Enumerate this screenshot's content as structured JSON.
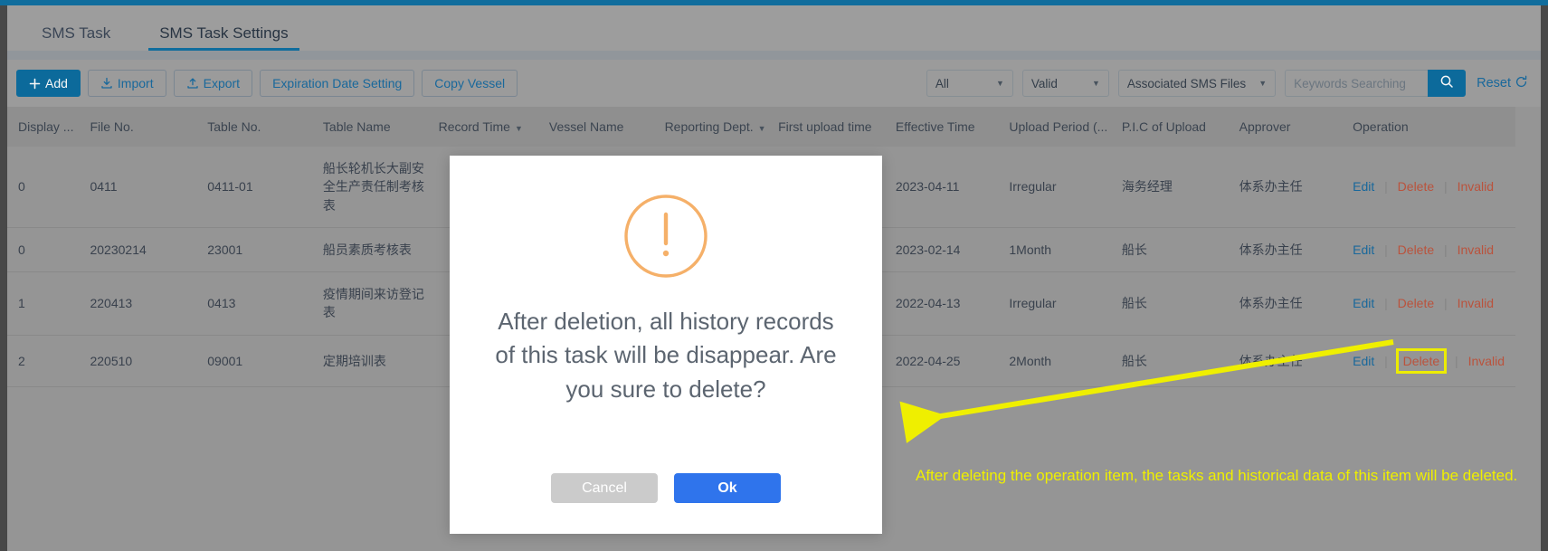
{
  "window": {
    "accent_blue": "#1171a3",
    "page_bg": "#9a9a9a"
  },
  "tabs": [
    {
      "label": "SMS Task",
      "active": false
    },
    {
      "label": "SMS Task Settings",
      "active": true
    }
  ],
  "toolbar": {
    "add_label": "Add",
    "import_label": "Import",
    "export_label": "Export",
    "expiration_label": "Expiration Date Setting",
    "copy_vessel_label": "Copy Vessel",
    "filter_all": "All",
    "filter_valid": "Valid",
    "filter_files": "Associated SMS Files",
    "search_placeholder": "Keywords Searching",
    "search_value": "",
    "reset_label": "Reset"
  },
  "table": {
    "columns": [
      {
        "label": "Display ...",
        "sortable": false
      },
      {
        "label": "File No.",
        "sortable": false
      },
      {
        "label": "Table No.",
        "sortable": false
      },
      {
        "label": "Table Name",
        "sortable": false
      },
      {
        "label": "Record Time",
        "sortable": true
      },
      {
        "label": "Vessel Name",
        "sortable": false
      },
      {
        "label": "Reporting Dept.",
        "sortable": true
      },
      {
        "label": "First upload time",
        "sortable": false
      },
      {
        "label": "Effective Time",
        "sortable": false
      },
      {
        "label": "Upload Period (...",
        "sortable": false
      },
      {
        "label": "P.I.C of Upload",
        "sortable": false
      },
      {
        "label": "Approver",
        "sortable": false
      },
      {
        "label": "Operation",
        "sortable": false
      }
    ],
    "rows": [
      {
        "display": "0",
        "file_no": "0411",
        "table_no": "0411-01",
        "table_name": "船长轮机长大副安全生产责任制考核表",
        "record_time": "",
        "vessel_name": "",
        "reporting_dept": "",
        "first_upload_time": "",
        "effective_time": "2023-04-11",
        "upload_period": "Irregular",
        "pic_of_upload": "海务经理",
        "approver": "体系办主任",
        "op_edit": "Edit",
        "op_delete": "Delete",
        "op_invalid": "Invalid",
        "delete_highlighted": false
      },
      {
        "display": "0",
        "file_no": "20230214",
        "table_no": "23001",
        "table_name": "船员素质考核表",
        "record_time": "",
        "vessel_name": "",
        "reporting_dept": "",
        "first_upload_time": "",
        "effective_time": "2023-02-14",
        "upload_period": "1Month",
        "pic_of_upload": "船长",
        "approver": "体系办主任",
        "op_edit": "Edit",
        "op_delete": "Delete",
        "op_invalid": "Invalid",
        "delete_highlighted": false
      },
      {
        "display": "1",
        "file_no": "220413",
        "table_no": "0413",
        "table_name": "疫情期间来访登记表",
        "record_time": "",
        "vessel_name": "",
        "reporting_dept": "",
        "first_upload_time": "",
        "effective_time": "2022-04-13",
        "upload_period": "Irregular",
        "pic_of_upload": "船长",
        "approver": "体系办主任",
        "op_edit": "Edit",
        "op_delete": "Delete",
        "op_invalid": "Invalid",
        "delete_highlighted": false
      },
      {
        "display": "2",
        "file_no": "220510",
        "table_no": "09001",
        "table_name": "定期培训表",
        "record_time": "",
        "vessel_name": "",
        "reporting_dept": "",
        "first_upload_time": "",
        "effective_time": "2022-04-25",
        "upload_period": "2Month",
        "pic_of_upload": "船长",
        "approver": "体系办主任",
        "op_edit": "Edit",
        "op_delete": "Delete",
        "op_invalid": "Invalid",
        "delete_highlighted": true
      }
    ]
  },
  "modal": {
    "message": "After deletion, all history records of this task will be disappear. Are you sure to delete?",
    "cancel_label": "Cancel",
    "ok_label": "Ok",
    "icon_color": "#f5b069",
    "ok_color": "#2f74ec"
  },
  "annotation": {
    "note": "After deleting the operation item, the tasks and historical data of this item will be deleted.",
    "color": "#f7f700"
  }
}
